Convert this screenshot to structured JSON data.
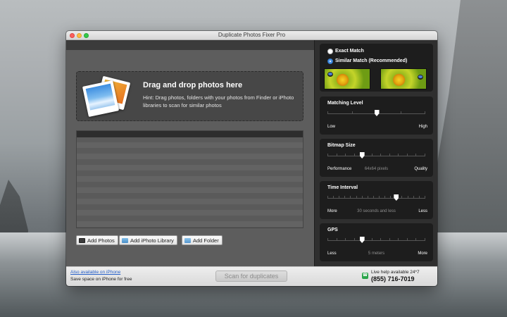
{
  "window": {
    "title": "Duplicate Photos Fixer Pro"
  },
  "dropzone": {
    "title": "Drag and drop photos here",
    "hint": "Hint: Drag photos, folders with your photos from Finder or iPhoto libraries to scan for similar photos"
  },
  "buttons": {
    "add_photos": "Add Photos",
    "add_iphoto": "Add iPhoto Library",
    "add_folder": "Add Folder",
    "scan": "Scan for duplicates"
  },
  "match": {
    "exact_label": "Exact Match",
    "similar_label": "Similar Match (Recommended)",
    "selected": "similar"
  },
  "settings": {
    "matching_level": {
      "title": "Matching Level",
      "min_label": "Low",
      "max_label": "High",
      "value": 0.5
    },
    "bitmap_size": {
      "title": "Bitmap Size",
      "min_label": "Performance",
      "value_label": "64x64 pixels",
      "max_label": "Quality",
      "value": 0.35
    },
    "time_interval": {
      "title": "Time Interval",
      "min_label": "More",
      "value_label": "30 seconds and less",
      "max_label": "Less",
      "value": 0.7
    },
    "gps": {
      "title": "GPS",
      "min_label": "Less",
      "value_label": "5 meters",
      "max_label": "More",
      "value": 0.35
    }
  },
  "footer": {
    "iphone_link": "Also available on iPhone",
    "iphone_sub": "Save space on iPhone for free",
    "help_label": "Live help available 24*7",
    "help_phone": "(855) 716-7019"
  },
  "icons": {
    "photos": "photos-icon",
    "iphoto": "iphoto-icon",
    "folder": "folder-icon",
    "phone": "phone-icon"
  },
  "colors": {
    "accent": "#4b93e6",
    "link": "#2760c9"
  }
}
